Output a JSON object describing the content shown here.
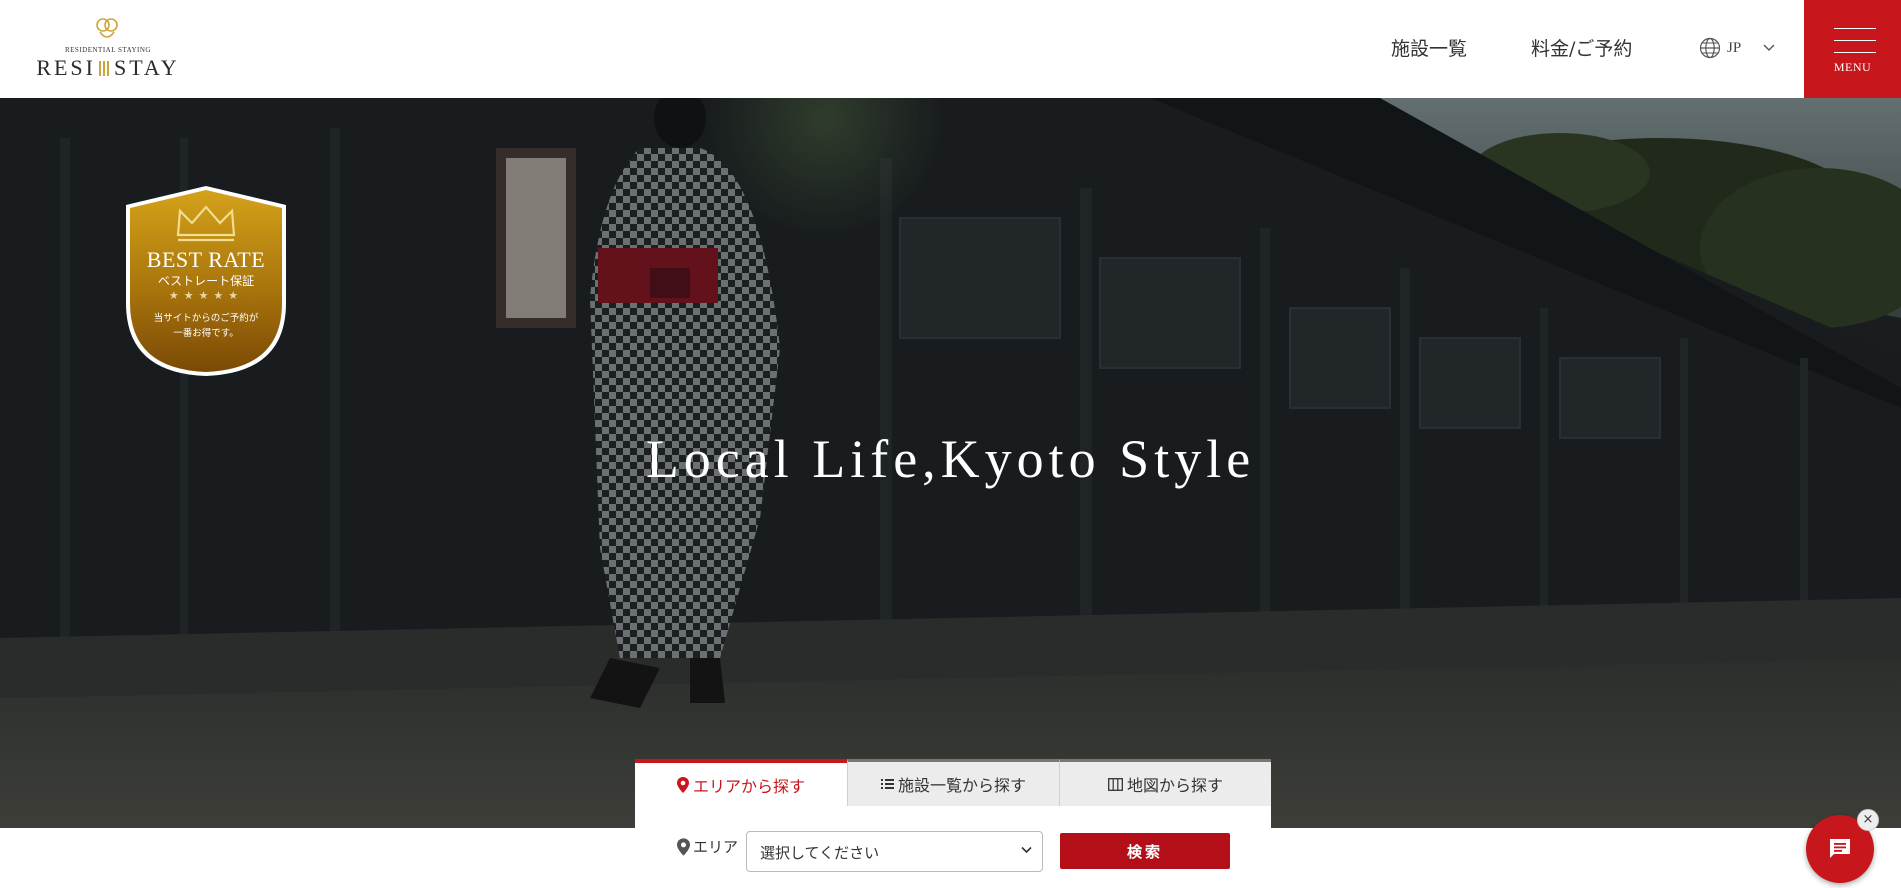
{
  "header": {
    "logo": {
      "subtitle": "RESIDENTIAL STAYING",
      "name_left": "RESI",
      "name_right": "STAY"
    },
    "nav": [
      "施設一覧",
      "料金/ご予約"
    ],
    "language": "JP",
    "menu_label": "MENU"
  },
  "hero": {
    "title": "Local Life,Kyoto Style",
    "badge": {
      "title": "BEST RATE",
      "subtitle": "ベストレート保証",
      "stars": "★★★★★",
      "note_line1": "当サイトからのご予約が",
      "note_line2": "一番お得です。"
    }
  },
  "search": {
    "tabs": [
      "エリアから探す",
      "施設一覧から探す",
      "地図から探す"
    ],
    "active_tab": "エリアから探す",
    "area_label": "エリア",
    "select_value": "選択してください",
    "submit_label": "検索"
  },
  "chat": {
    "close_symbol": "×"
  },
  "colors": {
    "brand_red": "#c8161d",
    "button_red": "#b40f18",
    "gold": "#b8860b"
  }
}
